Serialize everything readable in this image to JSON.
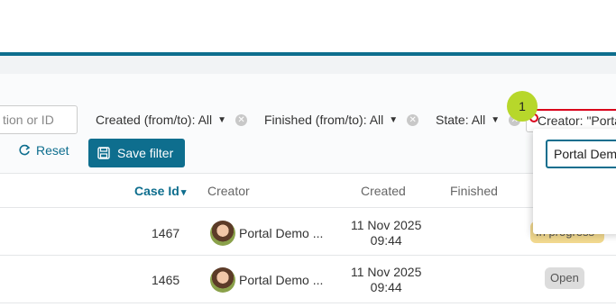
{
  "filters": {
    "search_placeholder": "tion or ID",
    "created": "Created (from/to): All",
    "finished": "Finished (from/to): All",
    "state": "State: All",
    "creator": "Creator: \"Portal",
    "reset_label": "Reset",
    "save_filter_label": "Save filter"
  },
  "annotation": {
    "number": "1"
  },
  "popover": {
    "input_value": "Portal Dem"
  },
  "table": {
    "headers": {
      "case_id": "Case Id",
      "creator": "Creator",
      "created": "Created",
      "finished": "Finished"
    },
    "rows": [
      {
        "case_id": "1467",
        "creator": "Portal Demo ...",
        "created_date": "11 Nov 2025",
        "created_time": "09:44",
        "status": "In progress"
      },
      {
        "case_id": "1465",
        "creator": "Portal Demo ...",
        "created_date": "11 Nov 2025",
        "created_time": "09:44",
        "status": "Open"
      }
    ]
  },
  "colors": {
    "accent": "#0e6e8e",
    "highlight": "#b7d72b",
    "alert": "#d9001b"
  },
  "icons": {
    "reset": "refresh-icon",
    "save": "floppy-disk-icon",
    "sort": "chevron-down-icon",
    "clear": "clear-circle-icon",
    "caret": "caret-down-icon"
  }
}
